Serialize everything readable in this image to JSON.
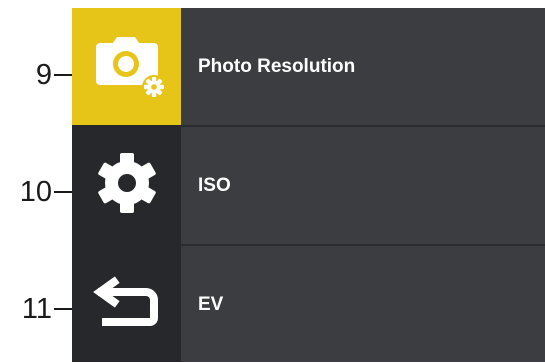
{
  "callouts": [
    "9",
    "10",
    "11"
  ],
  "menu": {
    "items": [
      {
        "icon": "camera-settings-icon",
        "label": "Photo Resolution",
        "selected": true
      },
      {
        "icon": "gear-icon",
        "label": "ISO",
        "selected": false
      },
      {
        "icon": "back-arrow-icon",
        "label": "EV",
        "selected": false
      }
    ]
  },
  "colors": {
    "selected_bg": "#e6c418",
    "icon_rail_bg": "#26282c",
    "panel_bg": "#3b3d41",
    "text": "#ffffff"
  }
}
